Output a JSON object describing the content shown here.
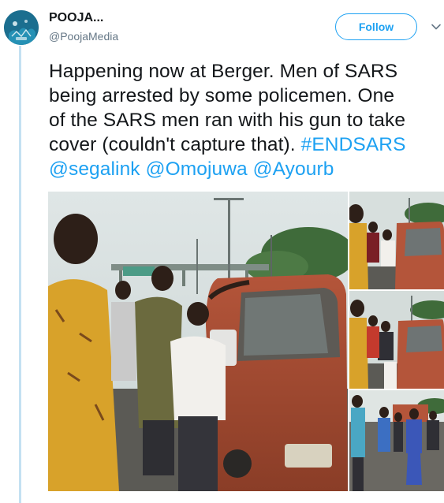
{
  "user": {
    "name": "POOJA...",
    "handle": "@PoojaMedia",
    "follow_label": "Follow"
  },
  "tweet": {
    "line1": "Happening now at Berger. Men of SARS",
    "line2": "being arrested by some policemen. One",
    "line3": "of the SARS men ran with his gun to take",
    "line4_text": "cover (couldn't capture that). ",
    "hashtag": "#ENDSARS",
    "mention1": "@segalink",
    "mention2": "@Omojuwa",
    "mention3": "@Ayourb"
  },
  "colors": {
    "accent": "#1da1f2",
    "thread_line": "#c4e1f2",
    "text": "#14171a",
    "secondary": "#657786"
  },
  "icons": {
    "avatar": "avatar",
    "more": "chevron-down-icon"
  }
}
